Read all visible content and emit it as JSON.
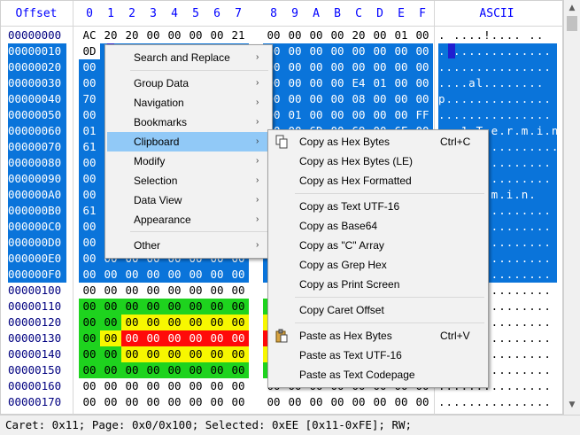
{
  "header": {
    "offset_label": "Offset",
    "columns": [
      "0",
      "1",
      "2",
      "3",
      "4",
      "5",
      "6",
      "7",
      "8",
      "9",
      "A",
      "B",
      "C",
      "D",
      "E",
      "F"
    ],
    "ascii_label": "ASCII"
  },
  "rows": [
    {
      "offset": "00000000",
      "hex": [
        "AC",
        "20",
        "20",
        "00",
        "00",
        "00",
        "00",
        "21",
        "00",
        "00",
        "00",
        "00",
        "20",
        "00",
        "01",
        "00"
      ],
      "ascii": ". ....!.... .."
    },
    {
      "offset": "00000010",
      "hex": [
        "0D",
        "01",
        "00",
        "00",
        "00",
        "00",
        "00",
        "00",
        "00",
        "00",
        "00",
        "00",
        "00",
        "00",
        "00",
        "00"
      ],
      "ascii": "..............."
    },
    {
      "offset": "00000020",
      "hex": [
        "00",
        "00",
        "00",
        "00",
        "00",
        "00",
        "00",
        "00",
        "00",
        "00",
        "00",
        "00",
        "00",
        "00",
        "00",
        "00"
      ],
      "ascii": "..............."
    },
    {
      "offset": "00000030",
      "hex": [
        "00",
        "00",
        "00",
        "00",
        "00",
        "00",
        "00",
        "00",
        "00",
        "00",
        "00",
        "00",
        "E4",
        "01",
        "00",
        "00"
      ],
      "ascii": "....al........"
    },
    {
      "offset": "00000040",
      "hex": [
        "70",
        "00",
        "00",
        "00",
        "00",
        "00",
        "00",
        "00",
        "00",
        "00",
        "00",
        "00",
        "08",
        "00",
        "00",
        "00"
      ],
      "ascii": "p.............."
    },
    {
      "offset": "00000050",
      "hex": [
        "00",
        "00",
        "00",
        "00",
        "00",
        "00",
        "00",
        "00",
        "00",
        "01",
        "00",
        "00",
        "00",
        "00",
        "00",
        "FF"
      ],
      "ascii": "..............."
    },
    {
      "offset": "00000060",
      "hex": [
        "01",
        "00",
        "00",
        "00",
        "00",
        "00",
        "00",
        "00",
        "00",
        "00",
        "6D",
        "00",
        "69",
        "00",
        "6E",
        "00"
      ],
      "ascii": "...1.T.e.r.m.i.n."
    },
    {
      "offset": "00000070",
      "hex": [
        "61",
        "00",
        "00",
        "00",
        "00",
        "00",
        "00",
        "00",
        "00",
        "00",
        "00",
        "00",
        "00",
        "00",
        "00",
        "00"
      ],
      "ascii": "a..............."
    },
    {
      "offset": "00000080",
      "hex": [
        "00",
        "00",
        "00",
        "00",
        "00",
        "00",
        "00",
        "00",
        "00",
        "00",
        "00",
        "00",
        "00",
        "00",
        "00",
        "00"
      ],
      "ascii": "..............."
    },
    {
      "offset": "00000090",
      "hex": [
        "00",
        "00",
        "00",
        "00",
        "00",
        "00",
        "00",
        "00",
        "00",
        "00",
        "00",
        "00",
        "00",
        "00",
        "00",
        "00"
      ],
      "ascii": "..............."
    },
    {
      "offset": "000000A0",
      "hex": [
        "00",
        "00",
        "00",
        "00",
        "00",
        "00",
        "00",
        "00",
        "00",
        "00",
        "00",
        "00",
        "00",
        "00",
        "00",
        "00"
      ],
      "ascii": "...e.r.m.i.n."
    },
    {
      "offset": "000000B0",
      "hex": [
        "61",
        "00",
        "00",
        "00",
        "00",
        "00",
        "00",
        "00",
        "00",
        "00",
        "00",
        "00",
        "00",
        "00",
        "00",
        "00"
      ],
      "ascii": "..............."
    },
    {
      "offset": "000000C0",
      "hex": [
        "00",
        "00",
        "00",
        "00",
        "00",
        "00",
        "00",
        "00",
        "00",
        "00",
        "00",
        "00",
        "00",
        "00",
        "00",
        "00"
      ],
      "ascii": "..............."
    },
    {
      "offset": "000000D0",
      "hex": [
        "00",
        "00",
        "00",
        "00",
        "00",
        "00",
        "00",
        "00",
        "00",
        "00",
        "00",
        "00",
        "00",
        "00",
        "00",
        "00"
      ],
      "ascii": "..............."
    },
    {
      "offset": "000000E0",
      "hex": [
        "00",
        "00",
        "00",
        "00",
        "00",
        "00",
        "00",
        "00",
        "00",
        "00",
        "00",
        "00",
        "00",
        "00",
        "00",
        "00"
      ],
      "ascii": "..............."
    },
    {
      "offset": "000000F0",
      "hex": [
        "00",
        "00",
        "00",
        "00",
        "00",
        "00",
        "00",
        "00",
        "00",
        "00",
        "00",
        "00",
        "00",
        "00",
        "00",
        "00"
      ],
      "ascii": "..............."
    },
    {
      "offset": "00000100",
      "hex": [
        "00",
        "00",
        "00",
        "00",
        "00",
        "00",
        "00",
        "00",
        "00",
        "00",
        "00",
        "00",
        "00",
        "00",
        "00",
        "00"
      ],
      "ascii": "..............."
    },
    {
      "offset": "00000110",
      "hex": [
        "00",
        "00",
        "00",
        "00",
        "00",
        "00",
        "00",
        "00",
        "00",
        "00",
        "00",
        "00",
        "00",
        "00",
        "00",
        "00"
      ],
      "ascii": "..............."
    },
    {
      "offset": "00000120",
      "hex": [
        "00",
        "00",
        "00",
        "00",
        "00",
        "00",
        "00",
        "00",
        "00",
        "00",
        "00",
        "00",
        "00",
        "00",
        "00",
        "00"
      ],
      "ascii": "..............."
    },
    {
      "offset": "00000130",
      "hex": [
        "00",
        "00",
        "00",
        "00",
        "00",
        "00",
        "00",
        "00",
        "00",
        "00",
        "00",
        "00",
        "00",
        "00",
        "00",
        "00"
      ],
      "ascii": "..............."
    },
    {
      "offset": "00000140",
      "hex": [
        "00",
        "00",
        "00",
        "00",
        "00",
        "00",
        "00",
        "00",
        "00",
        "00",
        "00",
        "00",
        "00",
        "00",
        "00",
        "00"
      ],
      "ascii": "..............."
    },
    {
      "offset": "00000150",
      "hex": [
        "00",
        "00",
        "00",
        "00",
        "00",
        "00",
        "00",
        "00",
        "00",
        "00",
        "00",
        "00",
        "00",
        "00",
        "00",
        "00"
      ],
      "ascii": "..............."
    },
    {
      "offset": "00000160",
      "hex": [
        "00",
        "00",
        "00",
        "00",
        "00",
        "00",
        "00",
        "00",
        "00",
        "00",
        "00",
        "00",
        "00",
        "00",
        "00",
        "00"
      ],
      "ascii": "..............."
    },
    {
      "offset": "00000170",
      "hex": [
        "00",
        "00",
        "00",
        "00",
        "00",
        "00",
        "00",
        "00",
        "00",
        "00",
        "00",
        "00",
        "00",
        "00",
        "00",
        "00"
      ],
      "ascii": "..............."
    }
  ],
  "status_bar": {
    "text": "Caret: 0x11; Page: 0x0/0x100; Selected: 0xEE [0x11-0xFE]; RW;"
  },
  "context_menu": {
    "items": [
      {
        "label": "Search and Replace",
        "submenu": true
      },
      {
        "label": "Group Data",
        "submenu": true
      },
      {
        "label": "Navigation",
        "submenu": true
      },
      {
        "label": "Bookmarks",
        "submenu": true
      },
      {
        "label": "Clipboard",
        "submenu": true,
        "highlighted": true
      },
      {
        "label": "Modify",
        "submenu": true
      },
      {
        "label": "Selection",
        "submenu": true
      },
      {
        "label": "Data View",
        "submenu": true
      },
      {
        "label": "Appearance",
        "submenu": true
      },
      {
        "label": "Other",
        "submenu": true
      }
    ],
    "arrow_glyph": "›"
  },
  "clipboard_menu": {
    "items": [
      {
        "label": "Copy as Hex Bytes",
        "shortcut": "Ctrl+C",
        "icon": "copy-icon"
      },
      {
        "label": "Copy as Hex Bytes (LE)",
        "shortcut": ""
      },
      {
        "label": "Copy as Hex Formatted",
        "shortcut": ""
      },
      {
        "label": "Copy as Text UTF-16",
        "shortcut": ""
      },
      {
        "label": "Copy as Base64",
        "shortcut": ""
      },
      {
        "label": "Copy as \"C\" Array",
        "shortcut": ""
      },
      {
        "label": "Copy as Grep Hex",
        "shortcut": ""
      },
      {
        "label": "Copy as Print Screen",
        "shortcut": ""
      },
      {
        "label": "Copy Caret Offset",
        "shortcut": ""
      },
      {
        "label": "Paste as Hex Bytes",
        "shortcut": "Ctrl+V",
        "icon": "paste-icon"
      },
      {
        "label": "Paste as Text UTF-16",
        "shortcut": ""
      },
      {
        "label": "Paste as Text Codepage",
        "shortcut": ""
      }
    ]
  },
  "colors": {
    "selection": "#0a74da",
    "header_text": "#0000ff",
    "menu_highlight": "#91c9f7",
    "bookmark_green": "#1ed31e",
    "bookmark_yellow": "#f7f700",
    "bookmark_red": "#ff0a0a"
  }
}
